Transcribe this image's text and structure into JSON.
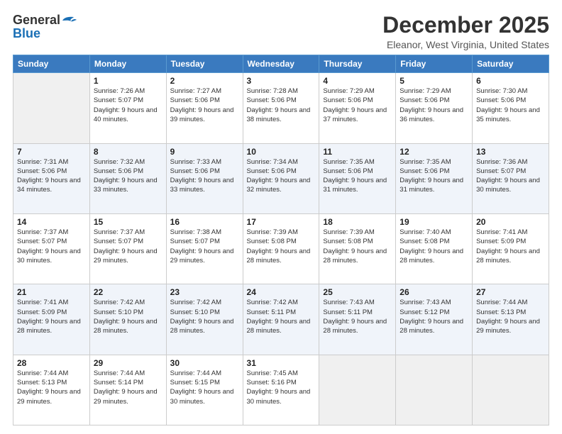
{
  "header": {
    "logo_general": "General",
    "logo_blue": "Blue",
    "month": "December 2025",
    "location": "Eleanor, West Virginia, United States"
  },
  "days_of_week": [
    "Sunday",
    "Monday",
    "Tuesday",
    "Wednesday",
    "Thursday",
    "Friday",
    "Saturday"
  ],
  "weeks": [
    [
      {
        "num": "",
        "sunrise": "",
        "sunset": "",
        "daylight": ""
      },
      {
        "num": "1",
        "sunrise": "Sunrise: 7:26 AM",
        "sunset": "Sunset: 5:07 PM",
        "daylight": "Daylight: 9 hours and 40 minutes."
      },
      {
        "num": "2",
        "sunrise": "Sunrise: 7:27 AM",
        "sunset": "Sunset: 5:06 PM",
        "daylight": "Daylight: 9 hours and 39 minutes."
      },
      {
        "num": "3",
        "sunrise": "Sunrise: 7:28 AM",
        "sunset": "Sunset: 5:06 PM",
        "daylight": "Daylight: 9 hours and 38 minutes."
      },
      {
        "num": "4",
        "sunrise": "Sunrise: 7:29 AM",
        "sunset": "Sunset: 5:06 PM",
        "daylight": "Daylight: 9 hours and 37 minutes."
      },
      {
        "num": "5",
        "sunrise": "Sunrise: 7:29 AM",
        "sunset": "Sunset: 5:06 PM",
        "daylight": "Daylight: 9 hours and 36 minutes."
      },
      {
        "num": "6",
        "sunrise": "Sunrise: 7:30 AM",
        "sunset": "Sunset: 5:06 PM",
        "daylight": "Daylight: 9 hours and 35 minutes."
      }
    ],
    [
      {
        "num": "7",
        "sunrise": "Sunrise: 7:31 AM",
        "sunset": "Sunset: 5:06 PM",
        "daylight": "Daylight: 9 hours and 34 minutes."
      },
      {
        "num": "8",
        "sunrise": "Sunrise: 7:32 AM",
        "sunset": "Sunset: 5:06 PM",
        "daylight": "Daylight: 9 hours and 33 minutes."
      },
      {
        "num": "9",
        "sunrise": "Sunrise: 7:33 AM",
        "sunset": "Sunset: 5:06 PM",
        "daylight": "Daylight: 9 hours and 33 minutes."
      },
      {
        "num": "10",
        "sunrise": "Sunrise: 7:34 AM",
        "sunset": "Sunset: 5:06 PM",
        "daylight": "Daylight: 9 hours and 32 minutes."
      },
      {
        "num": "11",
        "sunrise": "Sunrise: 7:35 AM",
        "sunset": "Sunset: 5:06 PM",
        "daylight": "Daylight: 9 hours and 31 minutes."
      },
      {
        "num": "12",
        "sunrise": "Sunrise: 7:35 AM",
        "sunset": "Sunset: 5:06 PM",
        "daylight": "Daylight: 9 hours and 31 minutes."
      },
      {
        "num": "13",
        "sunrise": "Sunrise: 7:36 AM",
        "sunset": "Sunset: 5:07 PM",
        "daylight": "Daylight: 9 hours and 30 minutes."
      }
    ],
    [
      {
        "num": "14",
        "sunrise": "Sunrise: 7:37 AM",
        "sunset": "Sunset: 5:07 PM",
        "daylight": "Daylight: 9 hours and 30 minutes."
      },
      {
        "num": "15",
        "sunrise": "Sunrise: 7:37 AM",
        "sunset": "Sunset: 5:07 PM",
        "daylight": "Daylight: 9 hours and 29 minutes."
      },
      {
        "num": "16",
        "sunrise": "Sunrise: 7:38 AM",
        "sunset": "Sunset: 5:07 PM",
        "daylight": "Daylight: 9 hours and 29 minutes."
      },
      {
        "num": "17",
        "sunrise": "Sunrise: 7:39 AM",
        "sunset": "Sunset: 5:08 PM",
        "daylight": "Daylight: 9 hours and 28 minutes."
      },
      {
        "num": "18",
        "sunrise": "Sunrise: 7:39 AM",
        "sunset": "Sunset: 5:08 PM",
        "daylight": "Daylight: 9 hours and 28 minutes."
      },
      {
        "num": "19",
        "sunrise": "Sunrise: 7:40 AM",
        "sunset": "Sunset: 5:08 PM",
        "daylight": "Daylight: 9 hours and 28 minutes."
      },
      {
        "num": "20",
        "sunrise": "Sunrise: 7:41 AM",
        "sunset": "Sunset: 5:09 PM",
        "daylight": "Daylight: 9 hours and 28 minutes."
      }
    ],
    [
      {
        "num": "21",
        "sunrise": "Sunrise: 7:41 AM",
        "sunset": "Sunset: 5:09 PM",
        "daylight": "Daylight: 9 hours and 28 minutes."
      },
      {
        "num": "22",
        "sunrise": "Sunrise: 7:42 AM",
        "sunset": "Sunset: 5:10 PM",
        "daylight": "Daylight: 9 hours and 28 minutes."
      },
      {
        "num": "23",
        "sunrise": "Sunrise: 7:42 AM",
        "sunset": "Sunset: 5:10 PM",
        "daylight": "Daylight: 9 hours and 28 minutes."
      },
      {
        "num": "24",
        "sunrise": "Sunrise: 7:42 AM",
        "sunset": "Sunset: 5:11 PM",
        "daylight": "Daylight: 9 hours and 28 minutes."
      },
      {
        "num": "25",
        "sunrise": "Sunrise: 7:43 AM",
        "sunset": "Sunset: 5:11 PM",
        "daylight": "Daylight: 9 hours and 28 minutes."
      },
      {
        "num": "26",
        "sunrise": "Sunrise: 7:43 AM",
        "sunset": "Sunset: 5:12 PM",
        "daylight": "Daylight: 9 hours and 28 minutes."
      },
      {
        "num": "27",
        "sunrise": "Sunrise: 7:44 AM",
        "sunset": "Sunset: 5:13 PM",
        "daylight": "Daylight: 9 hours and 29 minutes."
      }
    ],
    [
      {
        "num": "28",
        "sunrise": "Sunrise: 7:44 AM",
        "sunset": "Sunset: 5:13 PM",
        "daylight": "Daylight: 9 hours and 29 minutes."
      },
      {
        "num": "29",
        "sunrise": "Sunrise: 7:44 AM",
        "sunset": "Sunset: 5:14 PM",
        "daylight": "Daylight: 9 hours and 29 minutes."
      },
      {
        "num": "30",
        "sunrise": "Sunrise: 7:44 AM",
        "sunset": "Sunset: 5:15 PM",
        "daylight": "Daylight: 9 hours and 30 minutes."
      },
      {
        "num": "31",
        "sunrise": "Sunrise: 7:45 AM",
        "sunset": "Sunset: 5:16 PM",
        "daylight": "Daylight: 9 hours and 30 minutes."
      },
      {
        "num": "",
        "sunrise": "",
        "sunset": "",
        "daylight": ""
      },
      {
        "num": "",
        "sunrise": "",
        "sunset": "",
        "daylight": ""
      },
      {
        "num": "",
        "sunrise": "",
        "sunset": "",
        "daylight": ""
      }
    ]
  ]
}
